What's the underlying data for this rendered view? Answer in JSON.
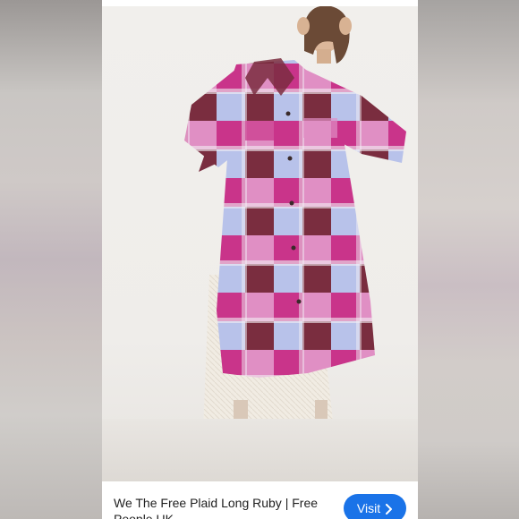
{
  "caption": {
    "title": "We The Free Plaid Long Ruby | Free People UK",
    "visit_label": "Visit"
  },
  "colors": {
    "button": "#1a73e8",
    "plaid_magenta": "#c9348a",
    "plaid_lavender": "#b8c2ea",
    "plaid_maroon": "#7a2d3f",
    "plaid_pink": "#e08fc4"
  },
  "icons": {
    "visit": "chevron-right-icon"
  }
}
